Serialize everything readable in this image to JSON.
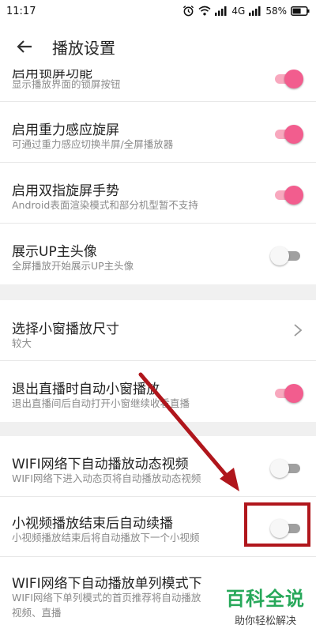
{
  "status": {
    "time": "11:17",
    "network": "4G",
    "battery": "58%",
    "icons": [
      "alarm-icon",
      "wifi-icon",
      "signal-icon",
      "battery-icon"
    ]
  },
  "header": {
    "title": "播放设置",
    "back_icon": "back-arrow-icon"
  },
  "settings": [
    {
      "title": "启用锁屏功能",
      "subtitle": "显示播放界面的锁屏按钮",
      "control": "toggle",
      "on": true
    },
    {
      "title": "启用重力感应旋屏",
      "subtitle": "可通过重力感应切换半屏/全屏播放器",
      "control": "toggle",
      "on": true
    },
    {
      "title": "启用双指旋屏手势",
      "subtitle": "Android表面渲染模式和部分机型暂不支持",
      "control": "toggle",
      "on": true
    },
    {
      "title": "展示UP主头像",
      "subtitle": "全屏播放开始展示UP主头像",
      "control": "toggle",
      "on": false
    },
    {
      "title": "选择小窗播放尺寸",
      "subtitle": "较大",
      "control": "chevron"
    },
    {
      "title": "退出直播时自动小窗播放",
      "subtitle": "退出直播间后自动打开小窗继续收看直播",
      "control": "toggle",
      "on": true
    },
    {
      "title": "WIFI网络下自动播放动态视频",
      "subtitle": "WIFI网络下进入动态页将自动播放动态视频",
      "control": "toggle",
      "on": false
    },
    {
      "title": "小视频播放结束后自动续播",
      "subtitle": "小视频播放结束后将自动播放下一个小视频",
      "control": "toggle",
      "on": false
    },
    {
      "title": "WIFI网络下自动播放单列模式下",
      "subtitle": "WIFI网络下单列模式的首页推荐将自动播放",
      "subtitle2": "视频、直播",
      "control": "none"
    }
  ],
  "colors": {
    "toggle_on": "#f25d8e",
    "toggle_off": "#f7f7f7",
    "annotation": "#b0161c",
    "watermark": "#27a85a"
  },
  "watermark": {
    "title": "百科全说",
    "subtitle": "助你轻松解决"
  }
}
